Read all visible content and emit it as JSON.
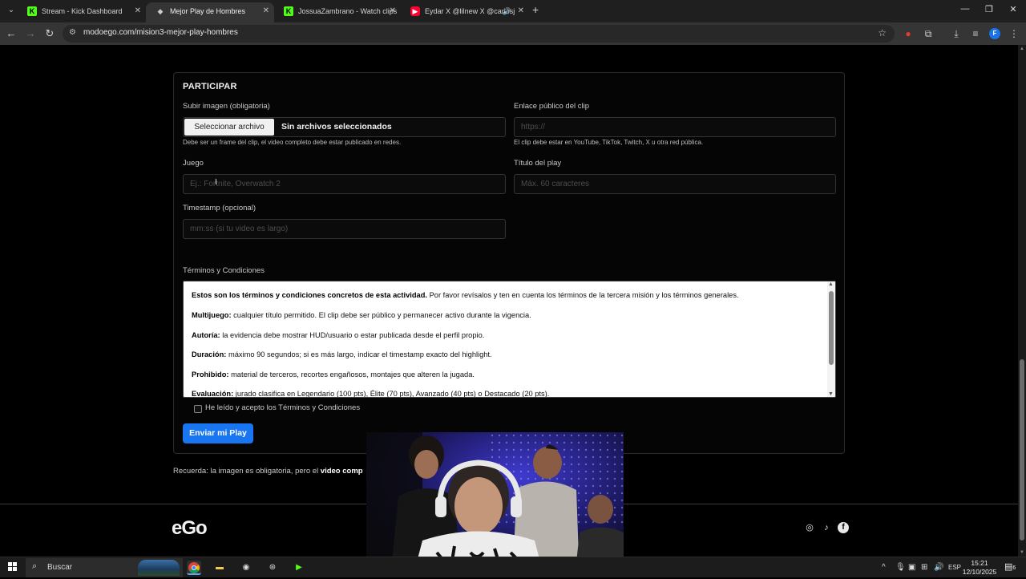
{
  "browser": {
    "tabs": [
      {
        "title": "Stream - Kick Dashboard",
        "favicon": "kick-icon",
        "active": false
      },
      {
        "title": "Mejor Play de Hombres",
        "favicon": "site-icon",
        "active": true
      },
      {
        "title": "JossuaZambrano - Watch clips",
        "favicon": "kick-icon",
        "active": false
      },
      {
        "title": "Eydar X @lilnew X @carlosj",
        "favicon": "youtube-icon",
        "active": false
      }
    ],
    "url": "modoego.com/mision3-mejor-play-hombres"
  },
  "form": {
    "section_title": "PARTICIPAR",
    "image_label": "Subir imagen (obligatoria)",
    "file_button": "Seleccionar archivo",
    "file_status": "Sin archivos seleccionados",
    "image_hint": "Debe ser un frame del clip, el video completo debe estar publicado en redes.",
    "link_label": "Enlace público del clip",
    "link_placeholder": "https://",
    "link_hint": "El clip debe estar en YouTube, TikTok, Twitch, X u otra red pública.",
    "game_label": "Juego",
    "game_placeholder": "Ej.: Fortnite, Overwatch 2",
    "play_title_label": "Título del play",
    "play_title_placeholder": "Máx. 60 caracteres",
    "timestamp_label": "Timestamp (opcional)",
    "timestamp_placeholder": "mm:ss (si tu video es largo)",
    "terms_label": "Términos y Condiciones",
    "terms": [
      {
        "bold": "Estos son los términos y condiciones concretos de esta actividad.",
        "text": " Por favor revísalos y ten en cuenta los términos de la tercera misión y los términos generales."
      },
      {
        "bold": "Multijuego:",
        "text": " cualquier título permitido. El clip debe ser público y permanecer activo durante la vigencia."
      },
      {
        "bold": "Autoría:",
        "text": " la evidencia debe mostrar HUD/usuario o estar publicada desde el perfil propio."
      },
      {
        "bold": "Duración:",
        "text": " máximo 90 segundos; si es más largo, indicar el timestamp exacto del highlight."
      },
      {
        "bold": "Prohibido:",
        "text": " material de terceros, recortes engañosos, montajes que alteren la jugada."
      },
      {
        "bold": "Evaluación:",
        "text": " jurado clasifica en Legendario (100 pts), Élite (70 pts), Avanzado (40 pts) o Destacado (20 pts)."
      }
    ],
    "accept_label": "He leído y acepto los Términos y Condiciones",
    "submit_label": "Enviar mi Play"
  },
  "note": {
    "prefix": "Recuerda: la imagen es obligatoria, pero el ",
    "bold": "video comp"
  },
  "footer": {
    "logo": "eGo",
    "social": [
      "instagram-icon",
      "tiktok-icon",
      "facebook-icon"
    ]
  },
  "taskbar": {
    "search_text": "Buscar",
    "language": "ESP",
    "time": "15:21",
    "date": "12/10/2025",
    "notifications": "6"
  }
}
